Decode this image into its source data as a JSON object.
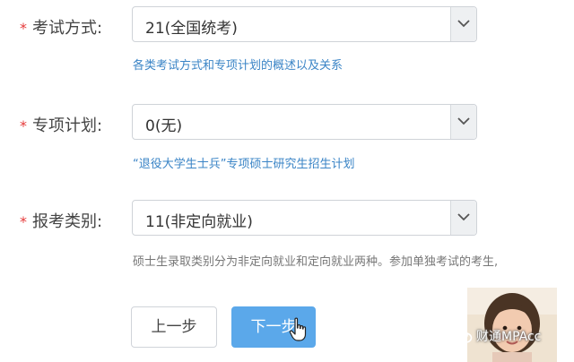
{
  "form": {
    "required_mark": "*",
    "exam_mode": {
      "label": "考试方式:",
      "value": "21(全国统考)",
      "hint": "各类考试方式和专项计划的概述以及关系"
    },
    "special_plan": {
      "label": "专项计划:",
      "value": "0(无)",
      "hint": "“退役大学生士兵”专项硕士研究生招生计划"
    },
    "application_type": {
      "label": "报考类别:",
      "value": "11(非定向就业)",
      "hint": "硕士生录取类别分为非定向就业和定向就业两种。参加单独考试的考生,"
    }
  },
  "buttons": {
    "prev_label": "上一步",
    "next_label": "下一步"
  },
  "overlay": {
    "watermark_text": "财通MPAcc",
    "icons": [
      "wechat-icon",
      "hand-pointer-icon",
      "chevron-down-icon"
    ]
  },
  "colors": {
    "required": "#e53a3a",
    "hint_link": "#3a84c6",
    "primary_button": "#5ba8ea"
  }
}
